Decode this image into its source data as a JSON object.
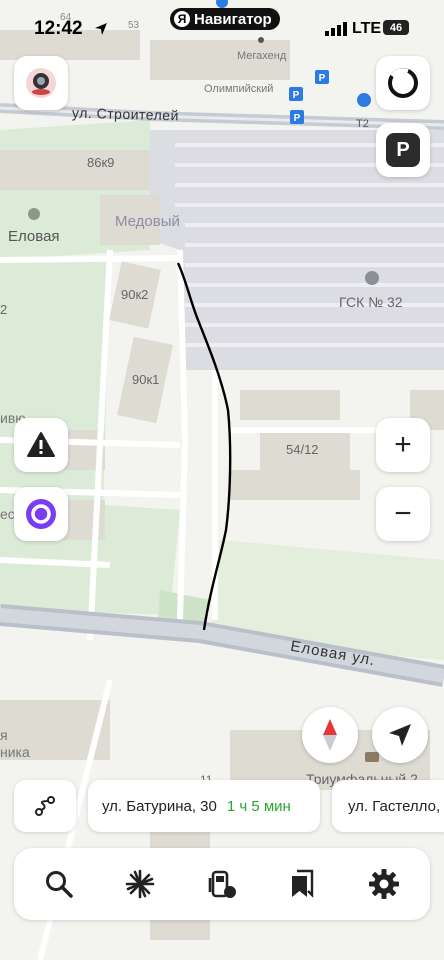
{
  "status_bar": {
    "time": "12:42",
    "app_pill": "Навигатор",
    "app_pill_logo": "Я",
    "network": "LTE",
    "battery": "46"
  },
  "map": {
    "street_labels": [
      "ул. Строителей",
      "Еловая ул."
    ],
    "place_labels": [
      "Мегахенд",
      "Олимпийский",
      "Т2",
      "86к9",
      "Еловая",
      "Медовый",
      "90к2",
      "ГСК № 32",
      "90к1",
      "54/12",
      "ника",
      "Триумфальный 2"
    ],
    "number_labels": [
      "64",
      "53",
      "2",
      "11"
    ],
    "cut_labels": [
      "ивю",
      "ест",
      "я"
    ]
  },
  "colors": {
    "route_line": "#000000",
    "alice_accent": "#7a3df1",
    "compass_red": "#e2363a",
    "duration_green": "#2aa52e",
    "parking_blue": "#2c7be5"
  },
  "icons": {
    "profile": "camera-avatar-icon",
    "layers": "circle-layers-icon",
    "parking": "parking-icon",
    "alert": "warning-icon",
    "alice": "alice-icon",
    "zoom_in": "plus-icon",
    "zoom_out": "minus-icon",
    "compass": "compass-icon",
    "locate": "navigation-arrow-icon",
    "route_variants": "route-icon",
    "search": "search-icon",
    "discover": "burst-icon",
    "fuel": "fuel-icon",
    "bookmarks": "bookmarks-icon",
    "settings": "gear-icon"
  },
  "buttons": {
    "parking_label": "P",
    "zoom_in": "+",
    "zoom_out": "−"
  },
  "routes": [
    {
      "destination": "ул. Батурина, 30",
      "duration": "1 ч 5 мин"
    },
    {
      "destination": "ул. Гастелло,",
      "duration": ""
    }
  ]
}
